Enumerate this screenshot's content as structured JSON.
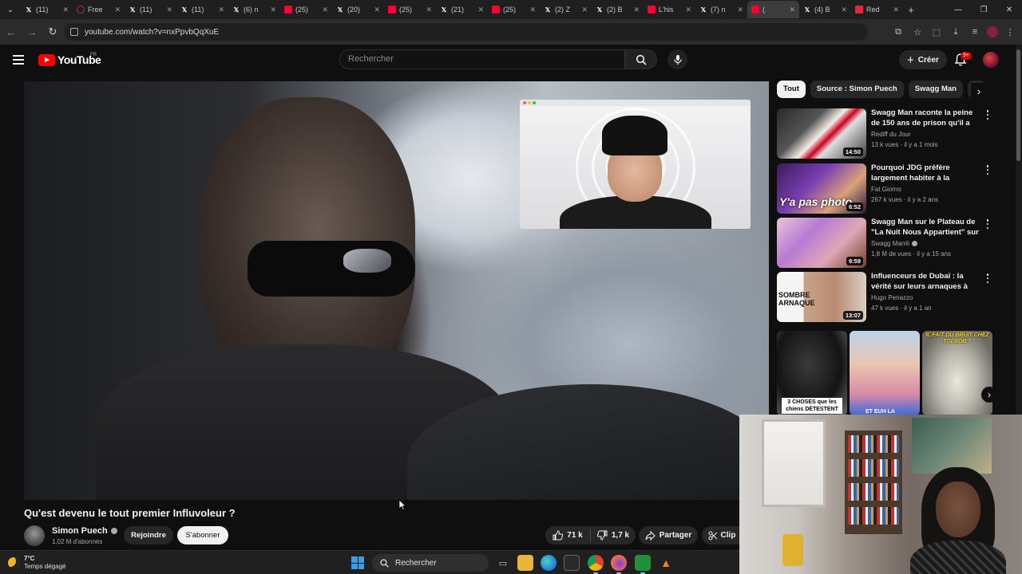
{
  "browser": {
    "tabs": [
      {
        "label": "(11)",
        "icon": "x-icon",
        "active": false
      },
      {
        "label": "Free",
        "icon": "circle-icon",
        "active": false
      },
      {
        "label": "(11)",
        "icon": "x-icon",
        "active": false
      },
      {
        "label": "(11)",
        "icon": "x-icon",
        "active": false
      },
      {
        "label": "(6) n",
        "icon": "x-icon",
        "active": false
      },
      {
        "label": "(25)",
        "icon": "youtube-icon",
        "active": false
      },
      {
        "label": "(20)",
        "icon": "x-icon",
        "active": false
      },
      {
        "label": "(25)",
        "icon": "youtube-icon",
        "active": false
      },
      {
        "label": "(21)",
        "icon": "x-icon",
        "active": false
      },
      {
        "label": "(25)",
        "icon": "youtube-icon",
        "active": false
      },
      {
        "label": "(2) Z",
        "icon": "x-icon",
        "active": false
      },
      {
        "label": "(2) B",
        "icon": "x-icon",
        "active": false
      },
      {
        "label": "L'his",
        "icon": "youtube-icon",
        "active": false
      },
      {
        "label": "(7) n",
        "icon": "x-icon",
        "active": false
      },
      {
        "label": "(",
        "icon": "youtube-icon",
        "active": true
      },
      {
        "label": "(4) B",
        "icon": "x-icon",
        "active": false
      },
      {
        "label": "Red",
        "icon": "red-square-icon",
        "active": false
      }
    ],
    "url": "youtube.com/watch?v=nxPpvbQqXuE"
  },
  "youtube": {
    "logo_text": "YouTube",
    "country_code": "FR",
    "search_placeholder": "Rechercher",
    "create_label": "Créer",
    "notif_badge": "9+"
  },
  "video": {
    "title": "Qu'est devenu le tout premier Influvoleur ?",
    "channel": "Simon Puech",
    "subscribers": "1,02 M d'abonnés",
    "join_label": "Rejoindre",
    "subscribe_label": "S'abonner",
    "likes": "71 k",
    "dislikes": "1,7 k",
    "share_label": "Partager",
    "clip_label": "Clip"
  },
  "chips": [
    "Tout",
    "Source : Simon Puech",
    "Swagg Man",
    "V"
  ],
  "recommendations": [
    {
      "title": "Swagg Man raconte la peine de 150 ans de prison qu'il a prit e...",
      "channel": "Rediff du Jour",
      "meta": "13 k vues · il y a 1 mois",
      "duration": "14:50",
      "verified": false,
      "thumb_text": ""
    },
    {
      "title": "Pourquoi JDG préfère largement habiter à la \"campagne\" plutôt ...",
      "channel": "Fat Giorno",
      "meta": "267 k vues · il y a 2 ans",
      "duration": "6:52",
      "verified": false,
      "thumb_text": "Y'a pas photo"
    },
    {
      "title": "Swagg Man sur le Plateau de \"La Nuit Nous Appartient\" sur ...",
      "channel": "Swagg Man®",
      "meta": "1,8 M de vues · il y a 15 ans",
      "duration": "9:59",
      "verified": true,
      "thumb_text": ""
    },
    {
      "title": "Influenceurs de Dubaï : la vérité sur leurs arnaques à plusieurs ...",
      "channel": "Hugo Penazzo",
      "meta": "47 k vues · il y a 1 an",
      "duration": "13:07",
      "verified": false,
      "thumb_text": "SOMBRE ARNAQUE"
    }
  ],
  "shorts": {
    "caption_1": "3 CHOSES que les chiens DÉTESTENT",
    "caption_2": "ET EUH LA",
    "caption_3": "IL FAIT DU BRUIT CHEZ TOI BOB ?"
  },
  "taskbar": {
    "temperature": "7°C",
    "weather": "Temps dégagé",
    "search_label": "Rechercher"
  },
  "colors": {
    "yt_red": "#ff0000",
    "background": "#0f0f0f",
    "chip_bg": "#272727",
    "taskbar_bg": "#202020"
  }
}
